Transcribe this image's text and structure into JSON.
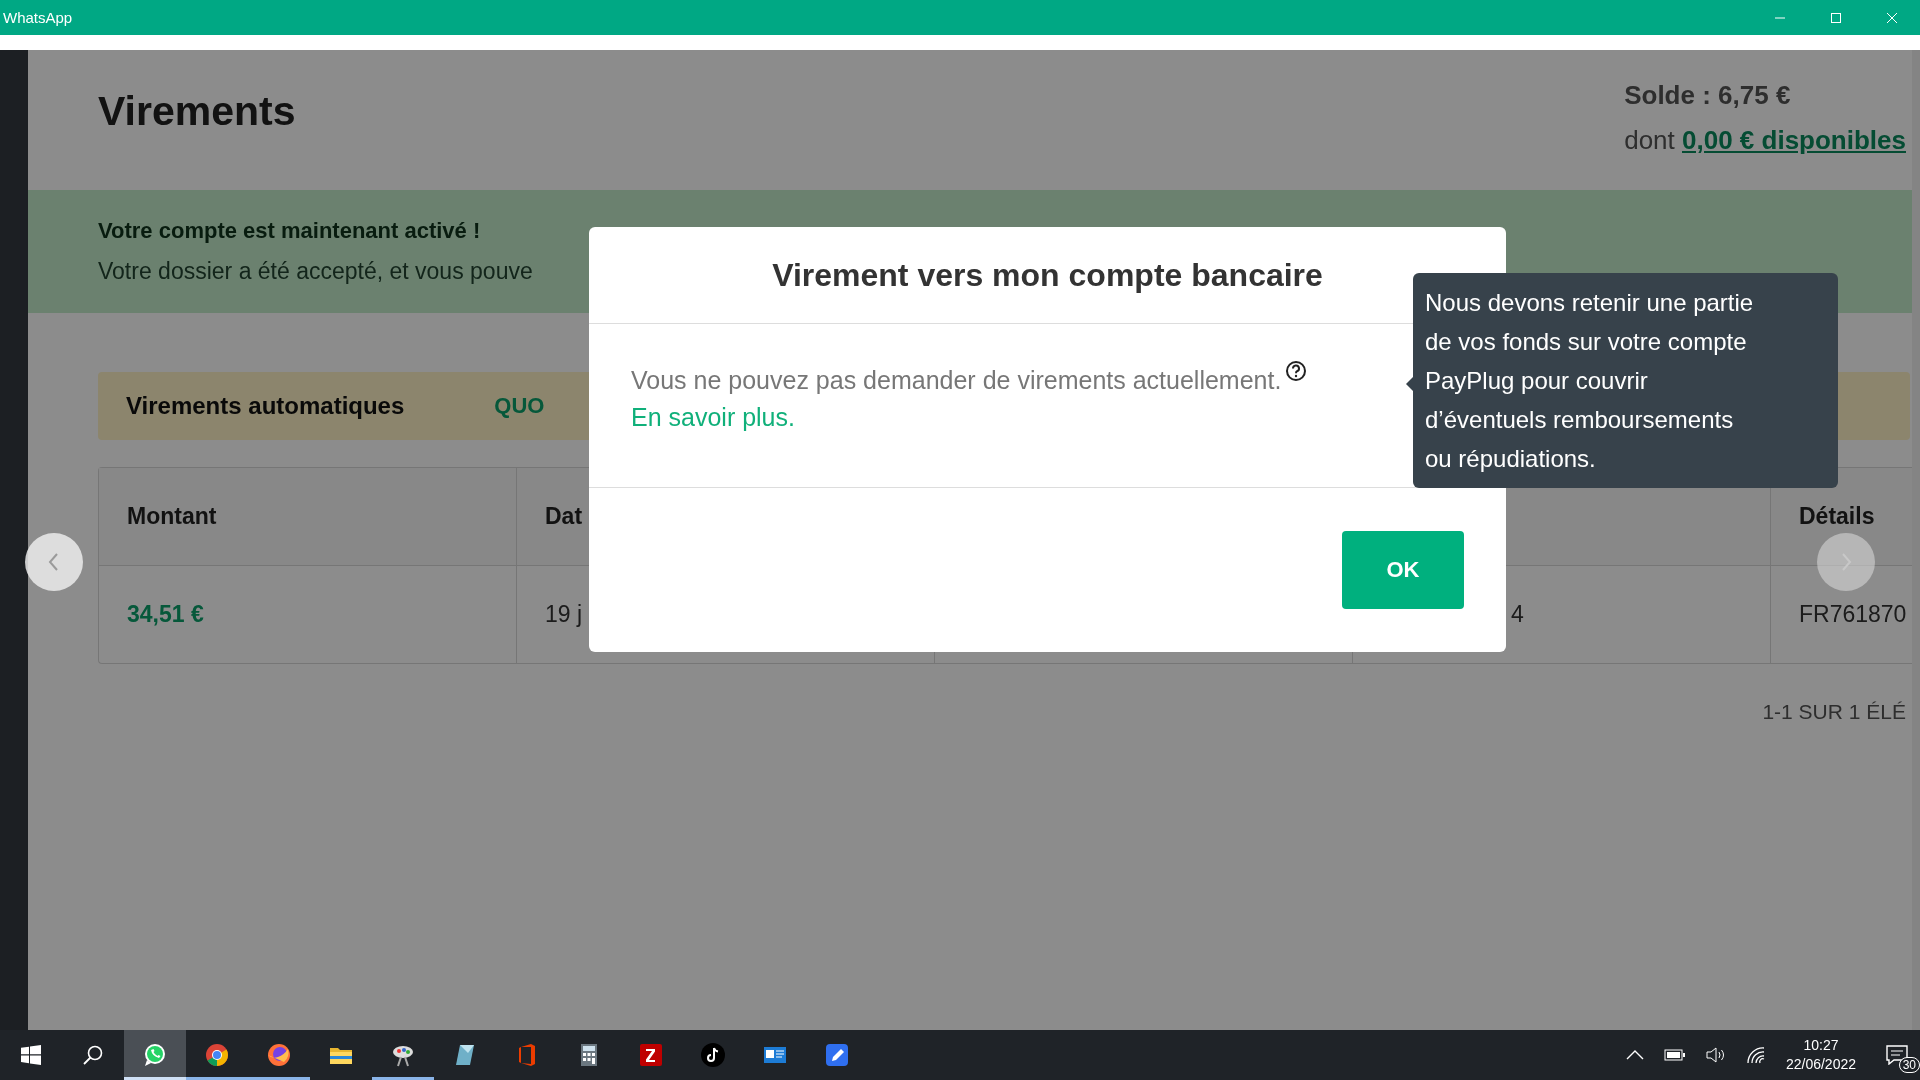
{
  "window": {
    "title": "WhatsApp"
  },
  "page": {
    "heading": "Virements",
    "balance": "Solde : 6,75 €",
    "available_prefix": "dont",
    "available_link": "0,00 € disponibles"
  },
  "banner": {
    "title": "Votre compte est maintenant activé !",
    "text": "Votre dossier a été accepté, et vous pouve"
  },
  "auto_transfers": {
    "label": "Virements automatiques",
    "column_2": "QUO"
  },
  "table": {
    "columns": [
      "Montant",
      "Dat",
      null,
      null,
      "Détails"
    ],
    "rows": [
      {
        "cells": [
          "34,51 €",
          "19 j",
          null,
          "4",
          "FR761870"
        ]
      }
    ]
  },
  "pagination": "1-1 SUR 1 ÉLÉ",
  "modal": {
    "title": "Virement vers mon compte bancaire",
    "message": "Vous ne pouvez pas demander de virements actuellement.",
    "link": "En savoir plus.",
    "ok_button": "OK"
  },
  "tooltip": {
    "text": "Nous devons retenir une partie\nde vos fonds sur votre compte\nPayPlug pour couvrir\nd’éventuels remboursements\nou répudiations."
  },
  "taskbar": {
    "apps": [
      {
        "kind": "whatsapp",
        "selected": true,
        "running": true
      },
      {
        "kind": "chrome",
        "selected": false,
        "running": true
      },
      {
        "kind": "firefox",
        "selected": false,
        "running": true
      },
      {
        "kind": "folder",
        "selected": false,
        "running": false
      },
      {
        "kind": "paint",
        "selected": false,
        "running": true
      },
      {
        "kind": "notes",
        "selected": false,
        "running": false
      },
      {
        "kind": "office",
        "selected": false,
        "running": false
      },
      {
        "kind": "calculator",
        "selected": false,
        "running": false
      },
      {
        "kind": "filezilla",
        "selected": false,
        "running": false
      },
      {
        "kind": "tiktok",
        "selected": false,
        "running": false
      },
      {
        "kind": "card",
        "selected": false,
        "running": false
      },
      {
        "kind": "pen",
        "selected": false,
        "running": false
      }
    ],
    "time": "10:27",
    "date": "22/06/2022",
    "notifications": "30"
  }
}
